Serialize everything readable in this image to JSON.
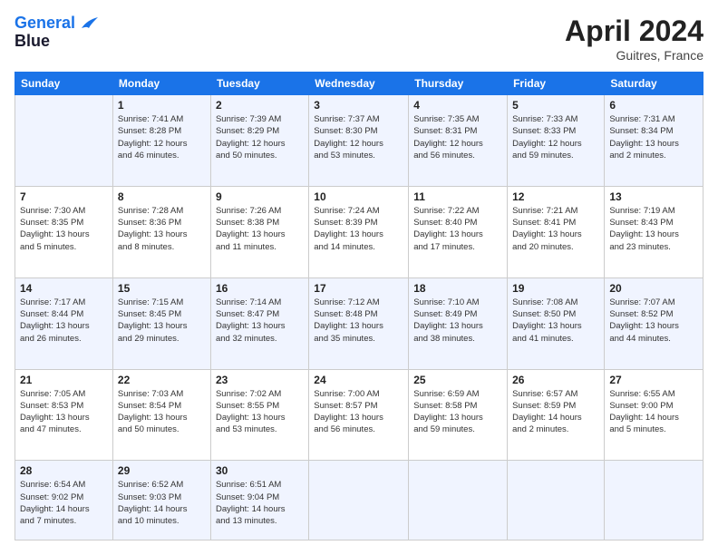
{
  "header": {
    "logo_line1": "General",
    "logo_line2": "Blue",
    "month": "April 2024",
    "location": "Guitres, France"
  },
  "weekdays": [
    "Sunday",
    "Monday",
    "Tuesday",
    "Wednesday",
    "Thursday",
    "Friday",
    "Saturday"
  ],
  "weeks": [
    [
      {
        "num": "",
        "info": ""
      },
      {
        "num": "1",
        "info": "Sunrise: 7:41 AM\nSunset: 8:28 PM\nDaylight: 12 hours\nand 46 minutes."
      },
      {
        "num": "2",
        "info": "Sunrise: 7:39 AM\nSunset: 8:29 PM\nDaylight: 12 hours\nand 50 minutes."
      },
      {
        "num": "3",
        "info": "Sunrise: 7:37 AM\nSunset: 8:30 PM\nDaylight: 12 hours\nand 53 minutes."
      },
      {
        "num": "4",
        "info": "Sunrise: 7:35 AM\nSunset: 8:31 PM\nDaylight: 12 hours\nand 56 minutes."
      },
      {
        "num": "5",
        "info": "Sunrise: 7:33 AM\nSunset: 8:33 PM\nDaylight: 12 hours\nand 59 minutes."
      },
      {
        "num": "6",
        "info": "Sunrise: 7:31 AM\nSunset: 8:34 PM\nDaylight: 13 hours\nand 2 minutes."
      }
    ],
    [
      {
        "num": "7",
        "info": "Sunrise: 7:30 AM\nSunset: 8:35 PM\nDaylight: 13 hours\nand 5 minutes."
      },
      {
        "num": "8",
        "info": "Sunrise: 7:28 AM\nSunset: 8:36 PM\nDaylight: 13 hours\nand 8 minutes."
      },
      {
        "num": "9",
        "info": "Sunrise: 7:26 AM\nSunset: 8:38 PM\nDaylight: 13 hours\nand 11 minutes."
      },
      {
        "num": "10",
        "info": "Sunrise: 7:24 AM\nSunset: 8:39 PM\nDaylight: 13 hours\nand 14 minutes."
      },
      {
        "num": "11",
        "info": "Sunrise: 7:22 AM\nSunset: 8:40 PM\nDaylight: 13 hours\nand 17 minutes."
      },
      {
        "num": "12",
        "info": "Sunrise: 7:21 AM\nSunset: 8:41 PM\nDaylight: 13 hours\nand 20 minutes."
      },
      {
        "num": "13",
        "info": "Sunrise: 7:19 AM\nSunset: 8:43 PM\nDaylight: 13 hours\nand 23 minutes."
      }
    ],
    [
      {
        "num": "14",
        "info": "Sunrise: 7:17 AM\nSunset: 8:44 PM\nDaylight: 13 hours\nand 26 minutes."
      },
      {
        "num": "15",
        "info": "Sunrise: 7:15 AM\nSunset: 8:45 PM\nDaylight: 13 hours\nand 29 minutes."
      },
      {
        "num": "16",
        "info": "Sunrise: 7:14 AM\nSunset: 8:47 PM\nDaylight: 13 hours\nand 32 minutes."
      },
      {
        "num": "17",
        "info": "Sunrise: 7:12 AM\nSunset: 8:48 PM\nDaylight: 13 hours\nand 35 minutes."
      },
      {
        "num": "18",
        "info": "Sunrise: 7:10 AM\nSunset: 8:49 PM\nDaylight: 13 hours\nand 38 minutes."
      },
      {
        "num": "19",
        "info": "Sunrise: 7:08 AM\nSunset: 8:50 PM\nDaylight: 13 hours\nand 41 minutes."
      },
      {
        "num": "20",
        "info": "Sunrise: 7:07 AM\nSunset: 8:52 PM\nDaylight: 13 hours\nand 44 minutes."
      }
    ],
    [
      {
        "num": "21",
        "info": "Sunrise: 7:05 AM\nSunset: 8:53 PM\nDaylight: 13 hours\nand 47 minutes."
      },
      {
        "num": "22",
        "info": "Sunrise: 7:03 AM\nSunset: 8:54 PM\nDaylight: 13 hours\nand 50 minutes."
      },
      {
        "num": "23",
        "info": "Sunrise: 7:02 AM\nSunset: 8:55 PM\nDaylight: 13 hours\nand 53 minutes."
      },
      {
        "num": "24",
        "info": "Sunrise: 7:00 AM\nSunset: 8:57 PM\nDaylight: 13 hours\nand 56 minutes."
      },
      {
        "num": "25",
        "info": "Sunrise: 6:59 AM\nSunset: 8:58 PM\nDaylight: 13 hours\nand 59 minutes."
      },
      {
        "num": "26",
        "info": "Sunrise: 6:57 AM\nSunset: 8:59 PM\nDaylight: 14 hours\nand 2 minutes."
      },
      {
        "num": "27",
        "info": "Sunrise: 6:55 AM\nSunset: 9:00 PM\nDaylight: 14 hours\nand 5 minutes."
      }
    ],
    [
      {
        "num": "28",
        "info": "Sunrise: 6:54 AM\nSunset: 9:02 PM\nDaylight: 14 hours\nand 7 minutes."
      },
      {
        "num": "29",
        "info": "Sunrise: 6:52 AM\nSunset: 9:03 PM\nDaylight: 14 hours\nand 10 minutes."
      },
      {
        "num": "30",
        "info": "Sunrise: 6:51 AM\nSunset: 9:04 PM\nDaylight: 14 hours\nand 13 minutes."
      },
      {
        "num": "",
        "info": ""
      },
      {
        "num": "",
        "info": ""
      },
      {
        "num": "",
        "info": ""
      },
      {
        "num": "",
        "info": ""
      }
    ]
  ]
}
